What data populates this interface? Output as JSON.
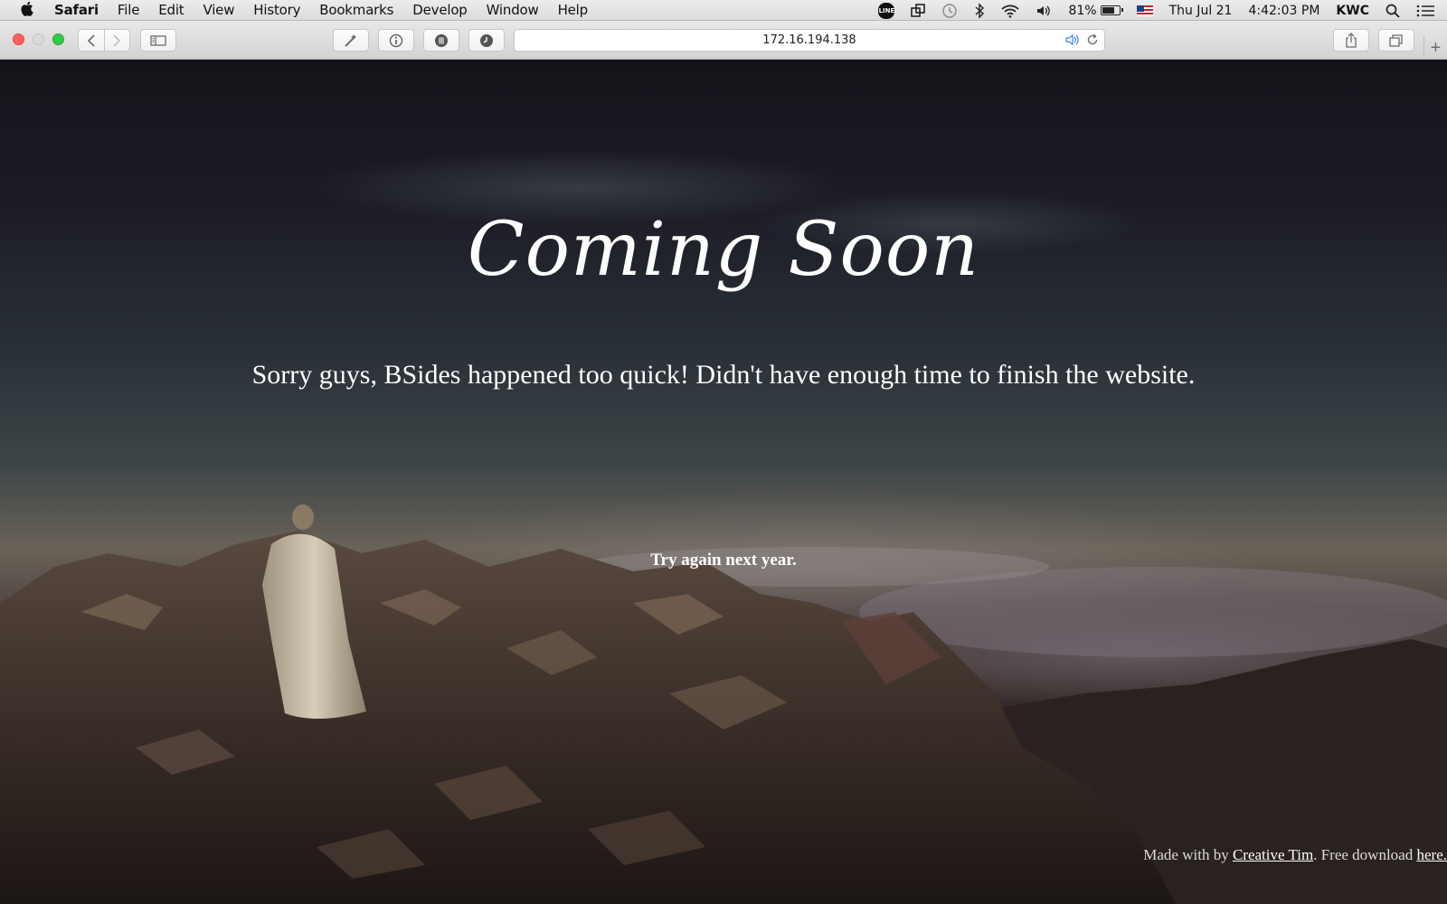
{
  "menubar": {
    "app_name": "Safari",
    "menus": [
      "File",
      "Edit",
      "View",
      "History",
      "Bookmarks",
      "Develop",
      "Window",
      "Help"
    ],
    "line_badge": "LINE",
    "battery_percent": "81%",
    "battery_level": 0.81,
    "date": "Thu Jul 21",
    "time": "4:42:03 PM",
    "user": "KWC"
  },
  "toolbar": {
    "url": "172.16.194.138",
    "new_tab_label": "+"
  },
  "page": {
    "title": "Coming Soon",
    "subtitle": "Sorry guys, BSides happened too quick! Didn't have enough time to finish the website.",
    "note": "Try again next year.",
    "footer": {
      "prefix": "Made with by ",
      "author_link": "Creative Tim",
      "middle": ". Free download ",
      "download_link": "here."
    }
  }
}
